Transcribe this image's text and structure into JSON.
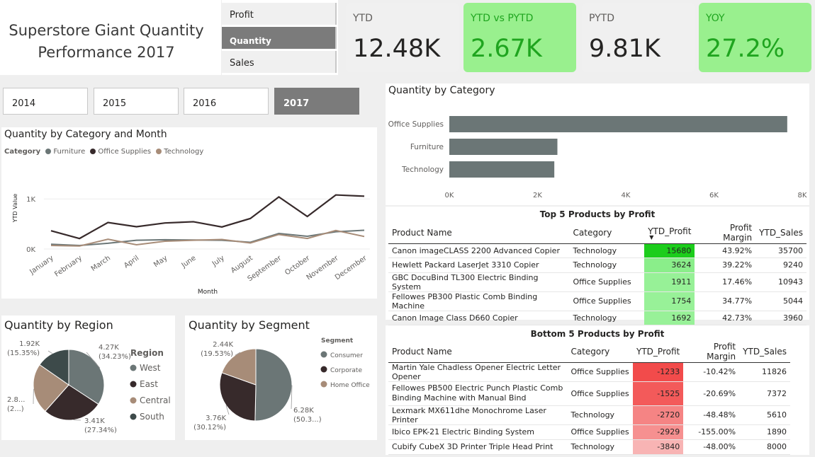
{
  "header": {
    "title_line1": "Superstore Giant Quantity",
    "title_line2": "Performance 2017"
  },
  "measure_selector": {
    "items": [
      "Profit",
      "Quantity",
      "Sales"
    ],
    "selected": "Quantity"
  },
  "kpis": [
    {
      "label": "YTD",
      "value": "12.48K",
      "highlight": false
    },
    {
      "label": "YTD vs PYTD",
      "value": "2.67K",
      "highlight": true
    },
    {
      "label": "PYTD",
      "value": "9.81K",
      "highlight": false
    },
    {
      "label": "YOY",
      "value": "27.2%",
      "highlight": true
    }
  ],
  "year_slicer": {
    "items": [
      "2014",
      "2015",
      "2016",
      "2017"
    ],
    "selected": "2017"
  },
  "colors": {
    "furniture": "#6b7676",
    "office_supplies": "#372a2b",
    "technology": "#a78c78",
    "highlight_green": "#99f08e",
    "kpi_green_text": "#1fa51f"
  },
  "chart_data": [
    {
      "type": "line",
      "title": "Quantity by Category and Month",
      "legend_title": "Category",
      "legend_position": "top-left",
      "xlabel": "Month",
      "ylabel": "YTD Value",
      "yticks": [
        "0K",
        "1K"
      ],
      "ylim": [
        0,
        1300
      ],
      "categories": [
        "January",
        "February",
        "March",
        "April",
        "May",
        "June",
        "July",
        "August",
        "September",
        "October",
        "November",
        "December"
      ],
      "series": [
        {
          "name": "Furniture",
          "color": "#6b7676",
          "values": [
            95,
            70,
            115,
            175,
            185,
            180,
            175,
            135,
            310,
            255,
            345,
            375
          ]
        },
        {
          "name": "Office Supplies",
          "color": "#372a2b",
          "values": [
            365,
            210,
            530,
            445,
            520,
            545,
            440,
            610,
            1040,
            650,
            1080,
            1055
          ]
        },
        {
          "name": "Technology",
          "color": "#a78c78",
          "values": [
            70,
            60,
            195,
            85,
            155,
            175,
            190,
            120,
            290,
            210,
            370,
            250
          ]
        }
      ]
    },
    {
      "type": "bar",
      "orientation": "horizontal",
      "title": "Quantity by Category",
      "categories": [
        "Office Supplies",
        "Furniture",
        "Technology"
      ],
      "values": [
        7660,
        2450,
        2380
      ],
      "xlim": [
        0,
        8000
      ],
      "xticks": [
        "0K",
        "2K",
        "4K",
        "6K",
        "8K"
      ],
      "color": "#6b7676"
    },
    {
      "type": "pie",
      "title": "Quantity by Region",
      "legend_title": "Region",
      "legend_position": "right",
      "slices": [
        {
          "name": "West",
          "value": 34.23,
          "color": "#6b7676",
          "label": "4.27K",
          "pct": "(34.23%)"
        },
        {
          "name": "East",
          "value": 27.34,
          "color": "#372a2b",
          "label": "3.41K",
          "pct": "(27.34%)"
        },
        {
          "name": "Central",
          "value": 23.08,
          "color": "#a78c78",
          "label": "2.8...",
          "pct": "(2...)"
        },
        {
          "name": "South",
          "value": 15.35,
          "color": "#3d4a4a",
          "label": "1.92K",
          "pct": "(15.35%)"
        }
      ]
    },
    {
      "type": "pie",
      "title": "Quantity by Segment",
      "legend_title": "Segment",
      "legend_position": "right",
      "slices": [
        {
          "name": "Consumer",
          "value": 50.35,
          "color": "#6b7676",
          "label": "6.28K",
          "pct": "(50.3...)"
        },
        {
          "name": "Corporate",
          "value": 30.12,
          "color": "#372a2b",
          "label": "3.76K",
          "pct": "(30.12%)"
        },
        {
          "name": "Home Office",
          "value": 19.53,
          "color": "#a78c78",
          "label": "2.44K",
          "pct": "(19.53%)"
        }
      ]
    }
  ],
  "top5": {
    "title": "Top 5 Products by Profit",
    "columns": [
      "Product Name",
      "Category",
      "YTD_Profit",
      "Profit Margin",
      "YTD_Sales"
    ],
    "rows": [
      [
        "Canon imageCLASS 2200 Advanced Copier",
        "Technology",
        "15680",
        "43.92%",
        "35700"
      ],
      [
        "Hewlett Packard LaserJet 3310 Copier",
        "Technology",
        "3624",
        "39.22%",
        "9240"
      ],
      [
        "GBC DocuBind TL300 Electric Binding System",
        "Office Supplies",
        "1911",
        "17.46%",
        "10943"
      ],
      [
        "Fellowes PB300 Plastic Comb Binding Machine",
        "Office Supplies",
        "1754",
        "34.77%",
        "5044"
      ],
      [
        "Canon Image Class D660 Copier",
        "Technology",
        "1692",
        "42.73%",
        "3960"
      ]
    ],
    "cell_colors": [
      "#1ccd1c",
      "#8aee8a",
      "#97f197",
      "#98f198",
      "#98f198"
    ]
  },
  "bottom5": {
    "title": "Bottom 5 Products by Profit",
    "columns": [
      "Product Name",
      "Category",
      "YTD_Profit",
      "Profit Margin",
      "YTD_Sales"
    ],
    "rows": [
      [
        "Martin Yale Chadless Opener Electric Letter Opener",
        "Office Supplies",
        "-1233",
        "-10.42%",
        "11826"
      ],
      [
        "Fellowes PB500 Electric Punch Plastic Comb Binding Machine with Manual Bind",
        "Office Supplies",
        "-1525",
        "-20.69%",
        "7372"
      ],
      [
        "Lexmark MX611dhe Monochrome Laser Printer",
        "Technology",
        "-2720",
        "-48.48%",
        "5610"
      ],
      [
        "Ibico EPK-21 Electric Binding System",
        "Office Supplies",
        "-2929",
        "-155.00%",
        "1890"
      ],
      [
        "Cubify CubeX 3D Printer Triple Head Print",
        "Technology",
        "-3840",
        "-48.00%",
        "8000"
      ]
    ],
    "cell_colors": [
      "#f24b4b",
      "#f35a5a",
      "#f58484",
      "#f69090",
      "#f8b4b4"
    ]
  }
}
